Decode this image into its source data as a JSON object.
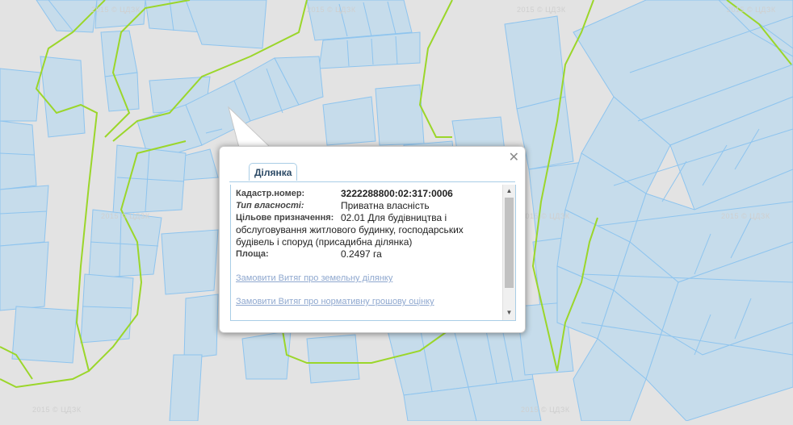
{
  "map": {
    "watermark": "2015 © ЦДЗК",
    "colors": {
      "background": "#e3e3e3",
      "parcel_fill": "#c6dceb",
      "parcel_stroke": "#8ec4ee",
      "boundary": "#9bd62a"
    }
  },
  "popup": {
    "close_icon": "✕",
    "tab_label": "Ділянка",
    "fields": {
      "cadastral_label": "Кадастр.номер:",
      "cadastral_value": "3222288800:02:317:0006",
      "ownership_label": "Тип власності:",
      "ownership_value": "Приватна власність",
      "purpose_label": "Цільове призначення:",
      "purpose_value_first": "02.01 Для будівництва і",
      "purpose_value_rest_1": "обслуговування житлового будинку, господарських",
      "purpose_value_rest_2": "будівель і споруд (присадибна ділянка)",
      "area_label": "Площа:",
      "area_value": "0.2497 га"
    },
    "links": {
      "land_extract": "Замовити Витяг про земельну ділянку",
      "valuation_extract": "Замовити Витяг про нормативну грошову оцінку"
    },
    "scroll": {
      "up_icon": "▲",
      "down_icon": "▼"
    }
  }
}
